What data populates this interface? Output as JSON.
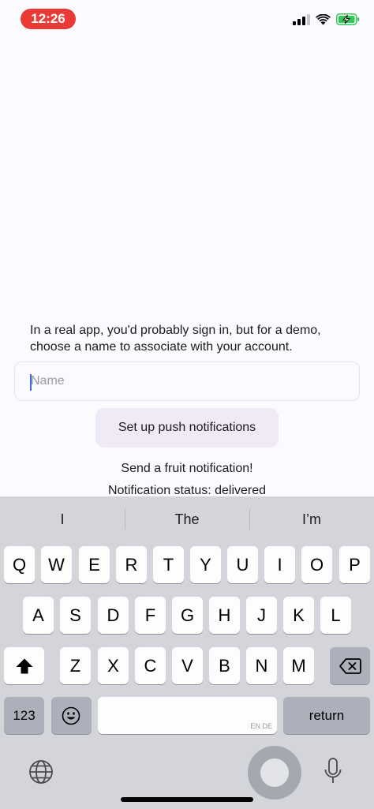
{
  "status_bar": {
    "time": "12:26"
  },
  "intro_text": "In a real app, you'd probably sign in, but for a demo, choose a name to associate with your account.",
  "name_input": {
    "placeholder": "Name",
    "value": ""
  },
  "push_button_label": "Set up push notifications",
  "fruit_link_label": "Send a fruit notification!",
  "notification_status": "Notification status: delivered",
  "keyboard": {
    "suggestions": [
      "I",
      "The",
      "I’m"
    ],
    "row1": [
      "Q",
      "W",
      "E",
      "R",
      "T",
      "Y",
      "U",
      "I",
      "O",
      "P"
    ],
    "row2": [
      "A",
      "S",
      "D",
      "F",
      "G",
      "H",
      "J",
      "K",
      "L"
    ],
    "row3": [
      "Z",
      "X",
      "C",
      "V",
      "B",
      "N",
      "M"
    ],
    "numbers_label": "123",
    "space_language": "EN DE",
    "return_label": "return",
    "icons": {
      "shift": "shift-icon",
      "delete": "delete-icon",
      "emoji": "emoji-icon",
      "globe": "globe-icon",
      "mic": "microphone-icon"
    }
  },
  "colors": {
    "time_pill": "#ea3a35",
    "background": "#fbfaff",
    "button_bg": "#efeaf5",
    "keyboard_bg": "#d3d5db",
    "battery": "#34c759"
  }
}
